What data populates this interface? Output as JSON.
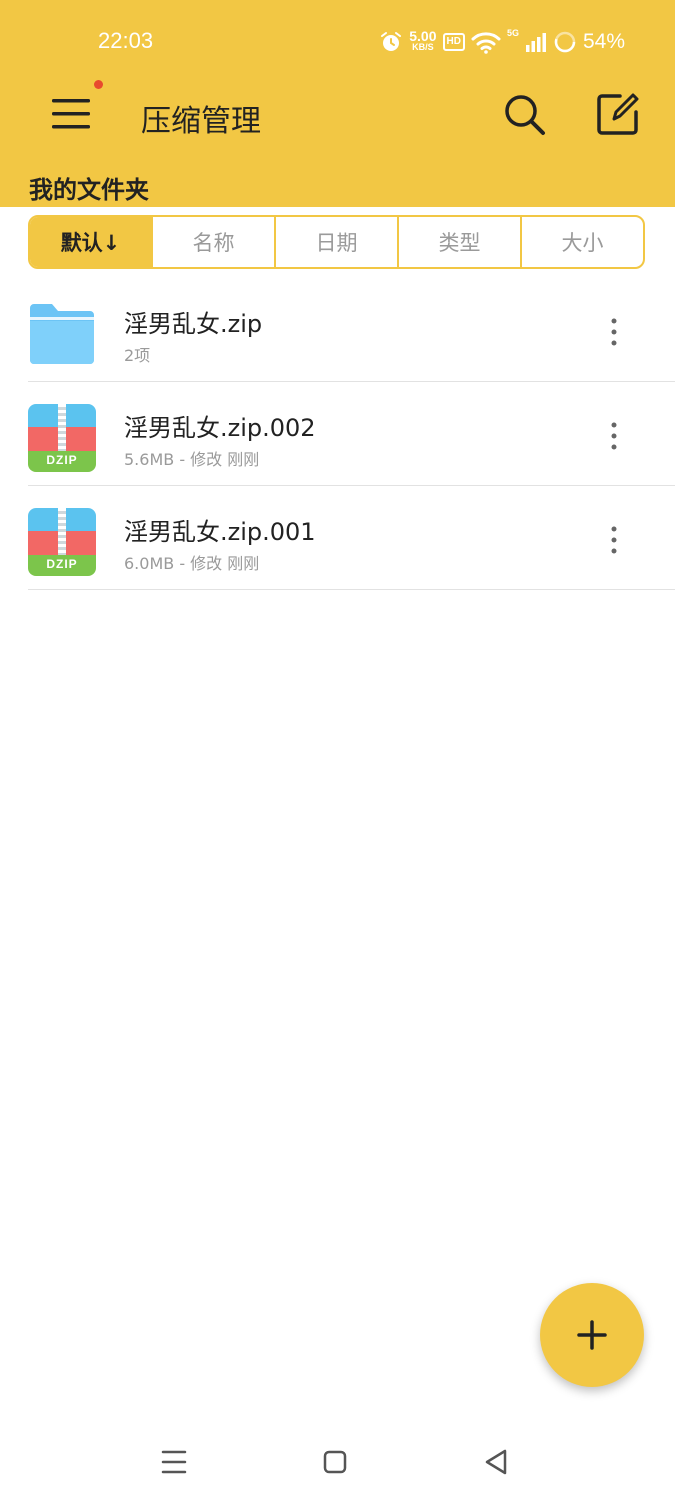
{
  "status_bar": {
    "time": "22:03",
    "net_speed_value": "5.00",
    "net_speed_unit": "KB/S",
    "hd_label": "HD",
    "network_label": "5G",
    "battery": "54%",
    "icons": [
      "alarm-icon",
      "wifi-icon",
      "signal-icon",
      "battery-icon"
    ]
  },
  "toolbar": {
    "title": "压缩管理",
    "menu_icon": "menu-icon",
    "search_icon": "search-icon",
    "edit_icon": "edit-icon",
    "has_notification": true
  },
  "section_title": "我的文件夹",
  "sort_tabs": [
    {
      "label": "默认↓",
      "active": true
    },
    {
      "label": "名称",
      "active": false
    },
    {
      "label": "日期",
      "active": false
    },
    {
      "label": "类型",
      "active": false
    },
    {
      "label": "大小",
      "active": false
    }
  ],
  "files": [
    {
      "name": "淫男乱女.zip",
      "meta": "2项",
      "type": "folder",
      "icon": "folder-icon"
    },
    {
      "name": "淫男乱女.zip.002",
      "meta": "5.6MB - 修改 刚刚",
      "type": "archive",
      "icon": "dzip-icon",
      "icon_text": "DZIP"
    },
    {
      "name": "淫男乱女.zip.001",
      "meta": "6.0MB - 修改 刚刚",
      "type": "archive",
      "icon": "dzip-icon",
      "icon_text": "DZIP"
    }
  ],
  "fab": {
    "icon": "plus-icon"
  },
  "navbar": {
    "icons": [
      "recent-apps-icon",
      "home-icon",
      "back-icon"
    ]
  },
  "colors": {
    "accent": "#F2C744",
    "notification_dot": "#E84A2E",
    "folder": "#6CC4F5"
  }
}
